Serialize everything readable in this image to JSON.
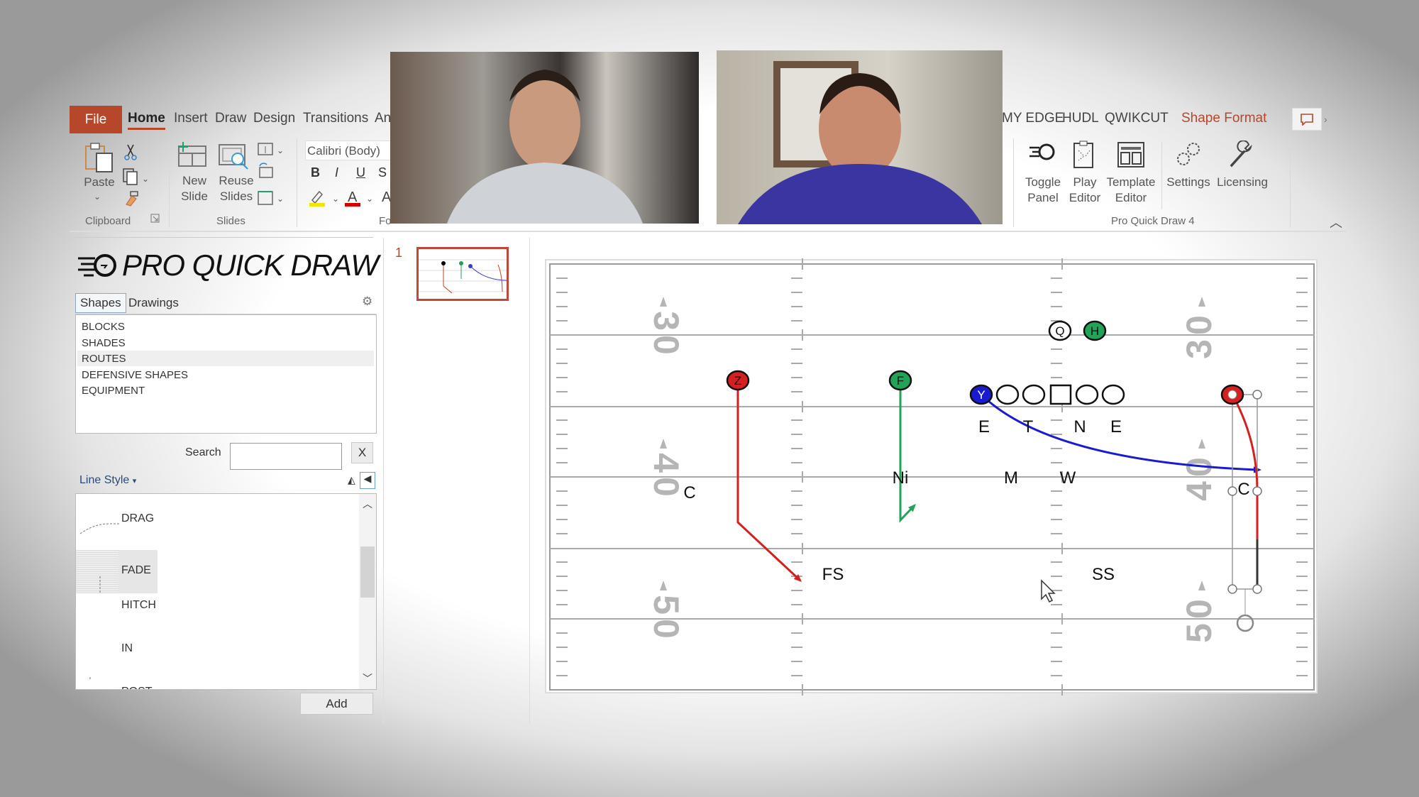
{
  "ribbon": {
    "tabs_left": [
      "File",
      "Home",
      "Insert",
      "Draw",
      "Design",
      "Transitions",
      "An"
    ],
    "tabs_right": [
      "MY EDGE",
      "HUDL",
      "QWIKCUT"
    ],
    "contextual_tab": "Shape Format",
    "clipboard": {
      "paste": "Paste",
      "group": "Clipboard"
    },
    "slides": {
      "new": "New",
      "new2": "Slide",
      "reuse": "Reuse",
      "reuse2": "Slides",
      "group": "Slides"
    },
    "font": {
      "name": "Calibri (Body)",
      "bold": "B",
      "italic": "I",
      "underline": "U",
      "strike": "S",
      "group_partial": "Fo",
      "highlight_color": "#f2e600",
      "font_color": "#d40000"
    },
    "pqd": {
      "buttons": [
        {
          "l1": "Toggle",
          "l2": "Panel",
          "icon": "toggle-panel-icon"
        },
        {
          "l1": "Play",
          "l2": "Editor",
          "icon": "clipboard-play-icon"
        },
        {
          "l1": "Template",
          "l2": "Editor",
          "icon": "template-icon"
        },
        {
          "l1": "Settings",
          "l2": "",
          "icon": "gears-icon"
        },
        {
          "l1": "Licensing",
          "l2": "",
          "icon": "wrench-icon"
        }
      ],
      "group": "Pro Quick Draw 4"
    },
    "accent": "#b7472a"
  },
  "panel": {
    "logo": "PRO QUICK DRAW",
    "tabs": [
      "Shapes",
      "Drawings"
    ],
    "categories": [
      "BLOCKS",
      "SHADES",
      "ROUTES",
      "DEFENSIVE SHAPES",
      "EQUIPMENT"
    ],
    "selected_category": "ROUTES",
    "search_label": "Search",
    "search_value": "",
    "clear_label": "X",
    "line_style_label": "Line Style",
    "routes": [
      "DRAG",
      "FADE",
      "HITCH",
      "IN",
      "POST"
    ],
    "selected_route": "FADE",
    "add_label": "Add"
  },
  "slides_pane": {
    "slide_number": "1"
  },
  "field": {
    "yard_numbers": [
      "30",
      "40",
      "50"
    ],
    "offense": [
      {
        "label": "Z",
        "color": "#d61f1f"
      },
      {
        "label": "F",
        "color": "#23a35a"
      },
      {
        "label": "Y",
        "color": "#1a1ad0"
      },
      {
        "label": "Q",
        "color": "#ffffff"
      },
      {
        "label": "H",
        "color": "#23a35a"
      },
      {
        "label": "",
        "color": "#d61f1f"
      }
    ],
    "defense": [
      "E",
      "T",
      "N",
      "E",
      "Ni",
      "M",
      "W",
      "C",
      "C",
      "FS",
      "SS"
    ]
  }
}
